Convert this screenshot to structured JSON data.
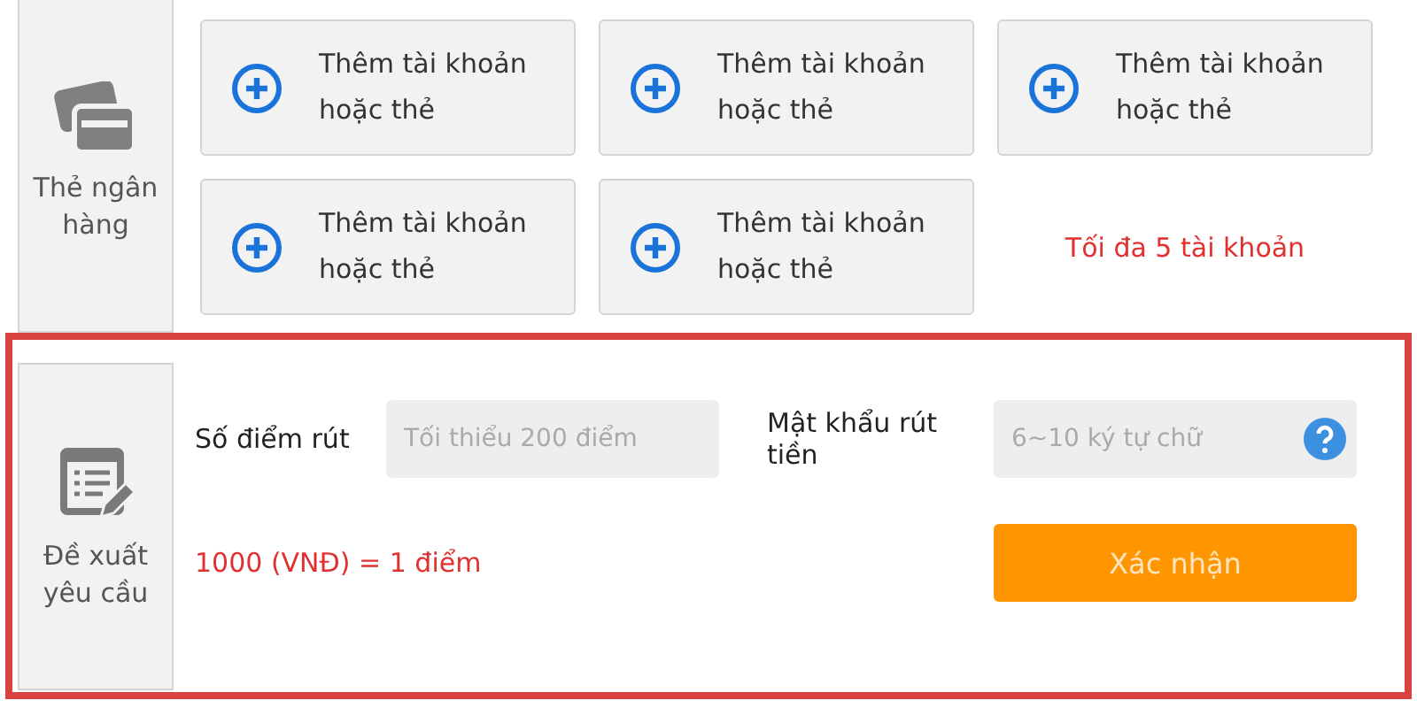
{
  "bank_section": {
    "label": "Thẻ ngân hàng",
    "cards": [
      {
        "kind": "add",
        "label": "Thêm tài khoản hoặc thẻ"
      },
      {
        "kind": "add",
        "label": "Thêm tài khoản hoặc thẻ"
      },
      {
        "kind": "add",
        "label": "Thêm tài khoản hoặc thẻ"
      },
      {
        "kind": "add",
        "label": "Thêm tài khoản hoặc thẻ"
      },
      {
        "kind": "add",
        "label": "Thêm tài khoản hoặc thẻ"
      },
      {
        "kind": "note",
        "label": "Tối đa 5 tài khoản"
      }
    ]
  },
  "request_section": {
    "label": "Đề xuất yêu cầu",
    "points_label": "Số điểm rút",
    "points_field": {
      "placeholder": "Tối thiểu 200 điểm"
    },
    "password_label": "Mật khẩu rút tiền",
    "password_field": {
      "placeholder": "6~10 ký tự chữ"
    },
    "rate": "1000 (VNĐ) = 1 điểm",
    "confirm_button": "Xác nhận"
  }
}
